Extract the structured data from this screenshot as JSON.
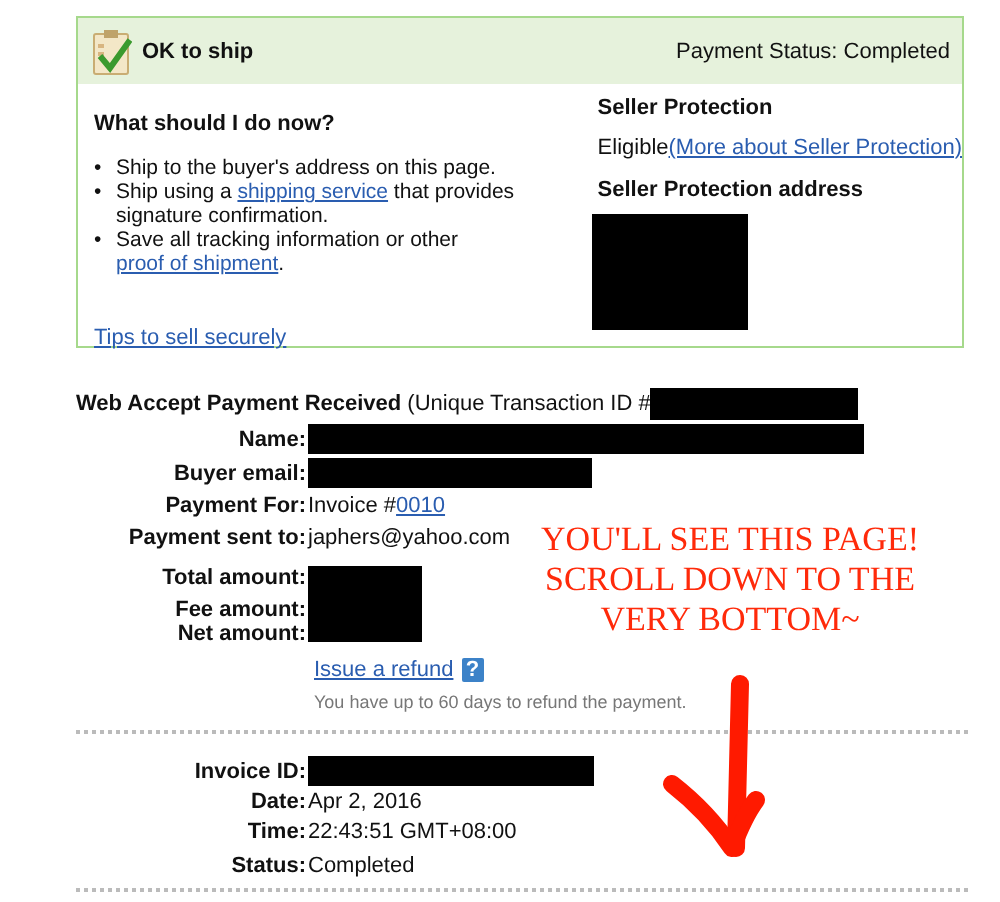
{
  "status_panel": {
    "title": "OK to ship",
    "payment_status": "Payment Status: Completed",
    "instructions": {
      "heading": "What should I do now?",
      "steps": [
        {
          "marker": "•",
          "parts": [
            {
              "text": "Ship to the buyer's address on this page.",
              "kind": "text"
            }
          ]
        },
        {
          "marker": "•",
          "parts": [
            {
              "text": "Ship using a ",
              "kind": "text"
            },
            {
              "text": "shipping service",
              "kind": "link"
            },
            {
              "text": " that provides signature confirmation.",
              "kind": "text"
            }
          ]
        },
        {
          "marker": "•",
          "parts": [
            {
              "text": "Save all tracking information or other ",
              "kind": "text"
            },
            {
              "text": "proof of shipment",
              "kind": "link"
            },
            {
              "text": ".",
              "kind": "text"
            }
          ]
        }
      ]
    },
    "tips_link": "Tips to sell securely",
    "seller_protection": {
      "heading": "Seller Protection",
      "status": "Eligible",
      "more_link": "(More about Seller Protection)",
      "address_heading": "Seller Protection address"
    }
  },
  "transaction": {
    "heading": "**Web Accept Payment Received** (Unique Transaction ID #",
    "rows": [
      {
        "label": "Name:",
        "kind": "redacted"
      },
      {
        "label": "Buyer email:",
        "kind": "redacted"
      },
      {
        "label": "Payment For:",
        "kind": "text",
        "value": "Invoice #",
        "link": "0010"
      },
      {
        "label": "Payment sent to:",
        "kind": "text",
        "value": "japhers@yahoo.com"
      }
    ],
    "amounts": [
      "Total amount:",
      "Fee amount:",
      "Net amount:"
    ],
    "refund": {
      "link": "Issue a refund",
      "help": "?",
      "note": "You have up to 60 days to refund the payment."
    },
    "invoice_rows": [
      {
        "label": "Invoice ID:",
        "kind": "redacted"
      },
      {
        "label": "Date:",
        "kind": "text",
        "value": "Apr 2, 2016"
      },
      {
        "label": "Time:",
        "kind": "text",
        "value": "22:43:51 GMT+08:00"
      },
      {
        "label": "Status:",
        "kind": "text",
        "value": "Completed"
      }
    ]
  },
  "annotation": {
    "lines": [
      "YOU'LL SEE THIS PAGE!",
      "SCROLL DOWN TO THE",
      "VERY BOTTOM~"
    ]
  }
}
